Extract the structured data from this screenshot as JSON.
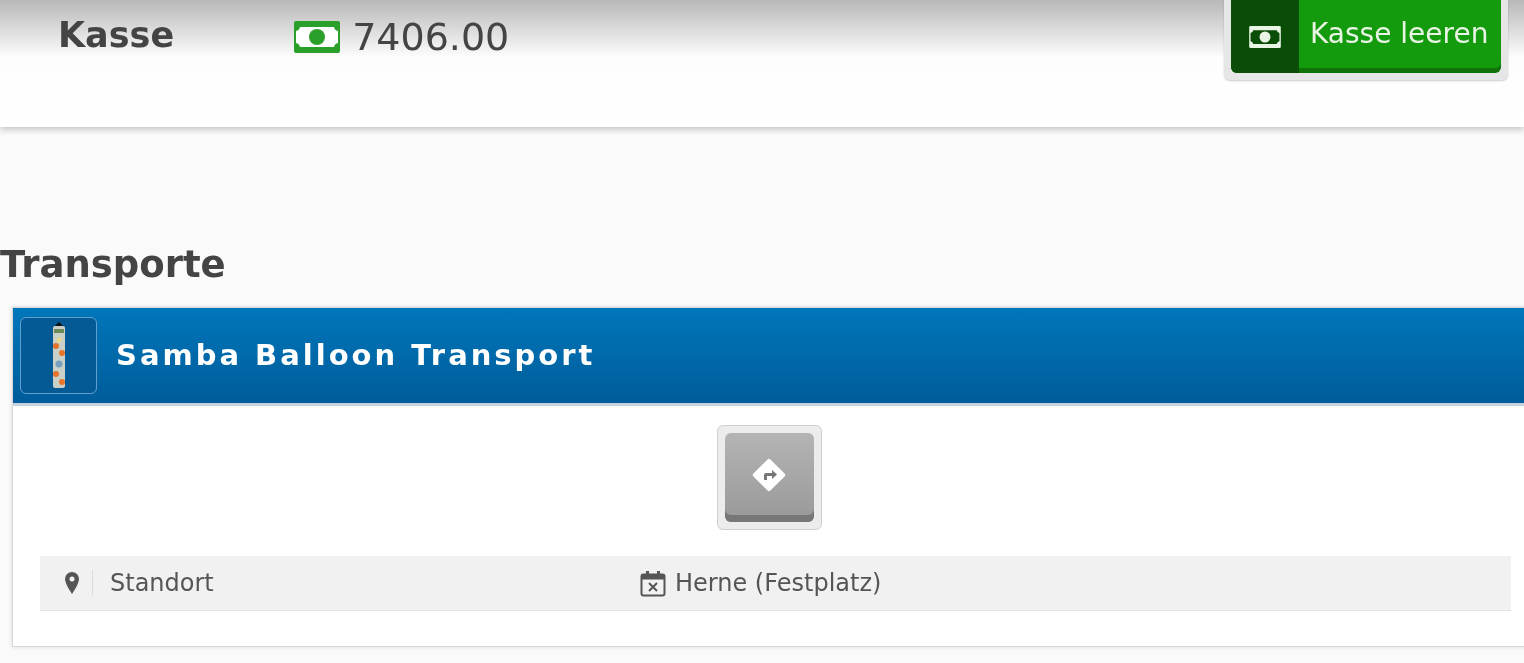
{
  "header": {
    "title": "Kasse",
    "balance": "7406.00",
    "button": "Kasse leeren"
  },
  "section_title": "Transporte",
  "transports": [
    {
      "name": "Samba Balloon Transport",
      "rows": [
        {
          "label": "Standort",
          "value": "Herne (Festplatz)"
        }
      ]
    }
  ]
}
